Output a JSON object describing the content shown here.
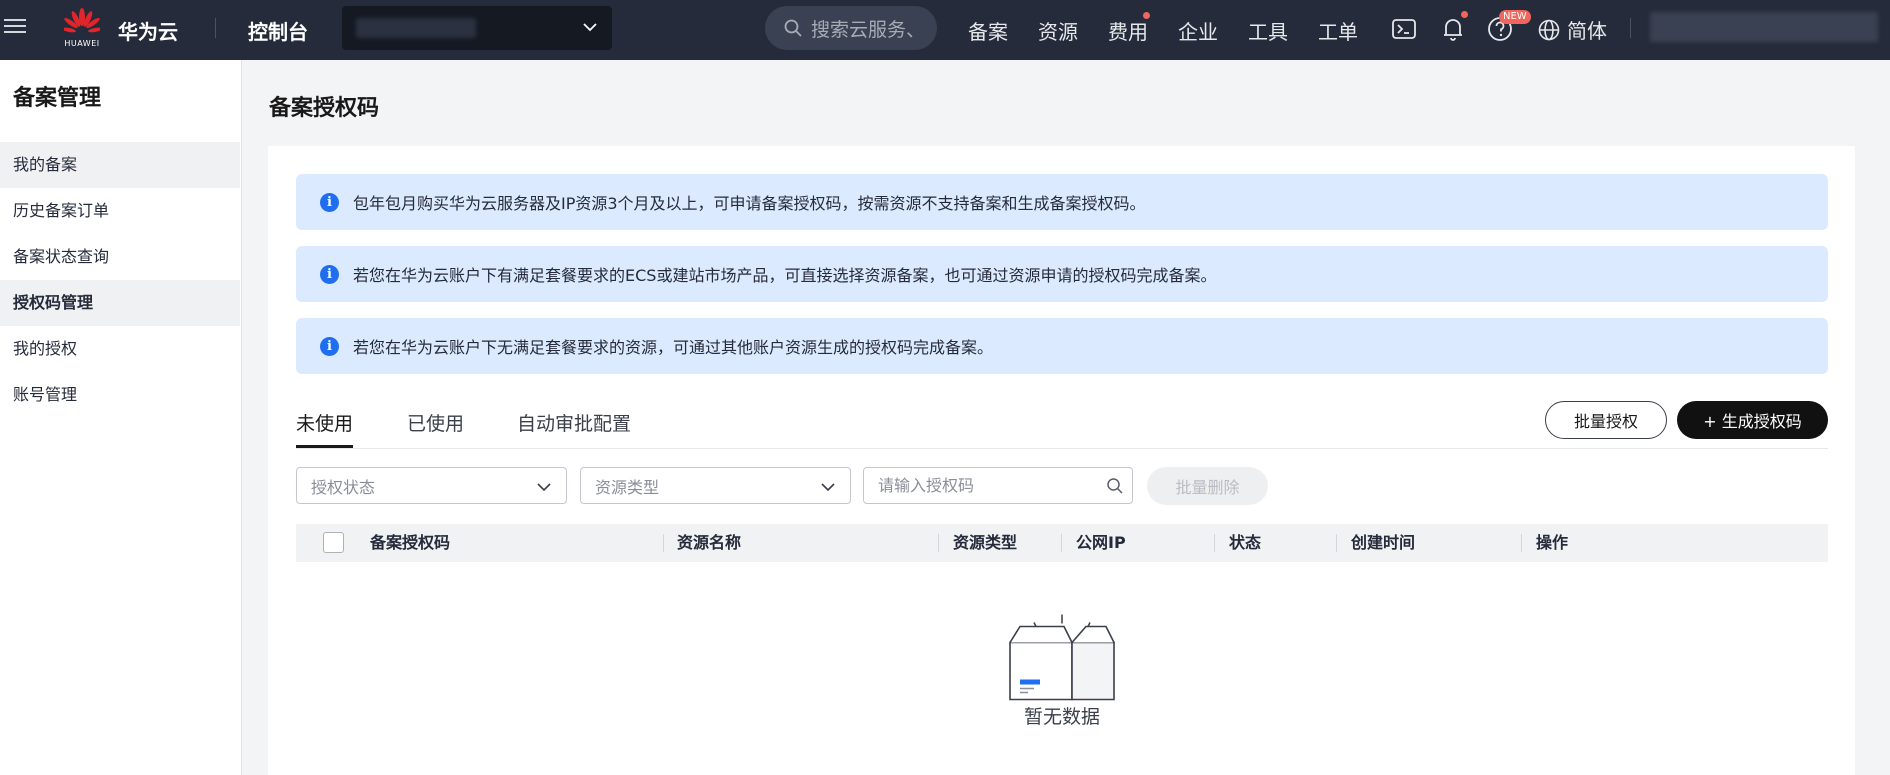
{
  "topbar": {
    "brand": "华为云",
    "logo_text": "HUAWEI",
    "console": "控制台",
    "search_placeholder": "搜索云服务、",
    "nav": [
      "备案",
      "资源",
      "费用",
      "企业",
      "工具",
      "工单"
    ],
    "new_badge": "NEW",
    "lang": "简体",
    "colors": {
      "bg": "#252b3a",
      "badge": "#f0655c"
    }
  },
  "sidebar": {
    "title": "备案管理",
    "items": [
      {
        "label": "我的备案",
        "highlight": true
      },
      {
        "label": "历史备案订单"
      },
      {
        "label": "备案状态查询"
      },
      {
        "label": "授权码管理",
        "active": true
      },
      {
        "label": "我的授权"
      },
      {
        "label": "账号管理"
      }
    ]
  },
  "main": {
    "title": "备案授权码",
    "notices": [
      "包年包月购买华为云服务器及IP资源3个月及以上，可申请备案授权码，按需资源不支持备案和生成备案授权码。",
      "若您在华为云账户下有满足套餐要求的ECS或建站市场产品，可直接选择资源备案，也可通过资源申请的授权码完成备案。",
      "若您在华为云账户下无满足套餐要求的资源，可通过其他账户资源生成的授权码完成备案。"
    ],
    "tabs": [
      {
        "label": "未使用",
        "active": true
      },
      {
        "label": "已使用"
      },
      {
        "label": "自动审批配置"
      }
    ],
    "batch_auth_label": "批量授权",
    "generate_label": "+ 生成授权码",
    "filters": {
      "status_placeholder": "授权状态",
      "type_placeholder": "资源类型",
      "code_placeholder": "请输入授权码",
      "batch_delete_label": "批量删除"
    },
    "columns": [
      "备案授权码",
      "资源名称",
      "资源类型",
      "公网IP",
      "状态",
      "创建时间",
      "操作"
    ],
    "rows": [],
    "empty_text": "暂无数据",
    "colors": {
      "info": "#1f6ef0",
      "notice_bg": "#dbeafe",
      "primary": "#111111"
    }
  }
}
